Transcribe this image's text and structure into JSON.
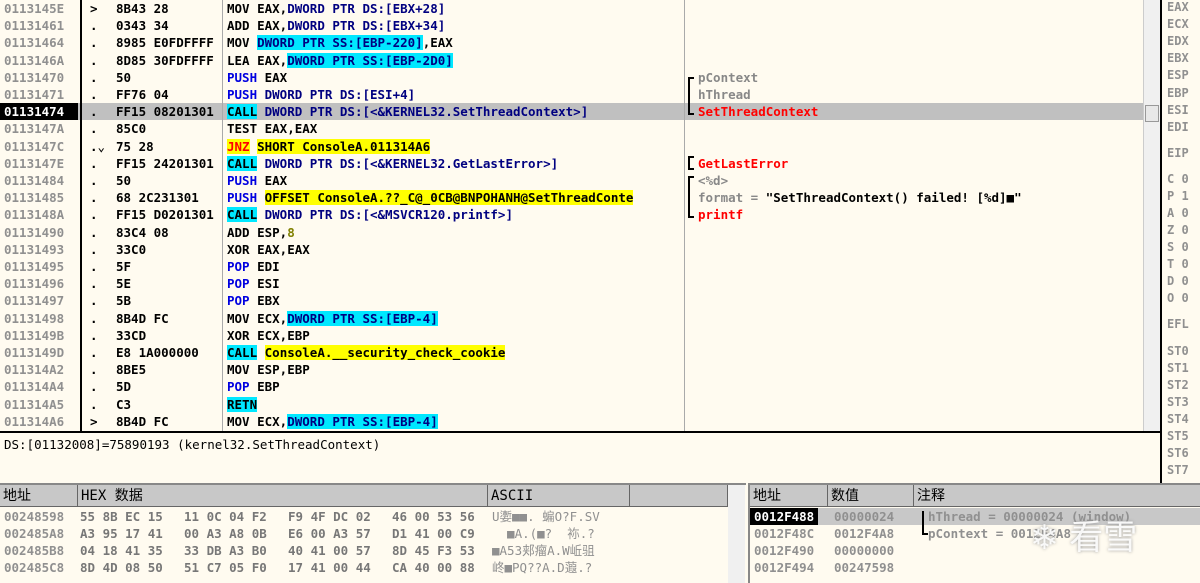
{
  "disasm": {
    "selected_index": 6,
    "rows": [
      {
        "addr": "0113145E",
        "mark": ">",
        "hex": "8B43 28",
        "asm": [
          [
            "MOV EAX,",
            "plain"
          ],
          [
            "DWORD PTR DS:[EBX+28]",
            "mem"
          ]
        ],
        "cmt": []
      },
      {
        "addr": "01131461",
        "mark": ".",
        "hex": "0343 34",
        "asm": [
          [
            "ADD EAX,",
            "plain"
          ],
          [
            "DWORD PTR DS:[EBX+34]",
            "mem"
          ]
        ],
        "cmt": []
      },
      {
        "addr": "01131464",
        "mark": ".",
        "hex": "8985 E0FDFFFF",
        "asm": [
          [
            "MOV ",
            "plain"
          ],
          [
            "DWORD PTR SS:[EBP-220]",
            "ss"
          ],
          [
            ",EAX",
            "plain"
          ]
        ],
        "cmt": []
      },
      {
        "addr": "0113146A",
        "mark": ".",
        "hex": "8D85 30FDFFFF",
        "asm": [
          [
            "LEA EAX,",
            "plain"
          ],
          [
            "DWORD PTR SS:[EBP-2D0]",
            "ss"
          ]
        ],
        "cmt": []
      },
      {
        "addr": "01131470",
        "mark": ".",
        "hex": "50",
        "asm": [
          [
            "PUSH",
            "push"
          ],
          [
            " EAX",
            "plain"
          ]
        ],
        "cmt": [
          [
            "pContext",
            "gray"
          ]
        ]
      },
      {
        "addr": "01131471",
        "mark": ".",
        "hex": "FF76 04",
        "asm": [
          [
            "PUSH",
            "push"
          ],
          [
            " DWORD PTR DS:[ESI+4]",
            "mem"
          ]
        ],
        "cmt": [
          [
            "hThread",
            "gray"
          ]
        ]
      },
      {
        "addr": "01131474",
        "mark": ".",
        "hex": "FF15 08201301",
        "asm": [
          [
            "CALL",
            "call"
          ],
          [
            " DWORD PTR DS:[<&KERNEL32.SetThreadContext>]",
            "mem"
          ]
        ],
        "cmt": [
          [
            "SetThreadContext",
            "red"
          ]
        ]
      },
      {
        "addr": "0113147A",
        "mark": ".",
        "hex": "85C0",
        "asm": [
          [
            "TEST EAX,EAX",
            "plain"
          ]
        ],
        "cmt": []
      },
      {
        "addr": "0113147C",
        "mark": ".⌄",
        "hex": "75 28",
        "asm": [
          [
            "JNZ",
            "jnz"
          ],
          [
            " ",
            "plain"
          ],
          [
            "SHORT ConsoleA.011314A6",
            "lbl"
          ]
        ],
        "cmt": []
      },
      {
        "addr": "0113147E",
        "mark": ".",
        "hex": "FF15 24201301",
        "asm": [
          [
            "CALL",
            "call"
          ],
          [
            " DWORD PTR DS:[<&KERNEL32.GetLastError>]",
            "mem"
          ]
        ],
        "cmt": [
          [
            "GetLastError",
            "red"
          ]
        ]
      },
      {
        "addr": "01131484",
        "mark": ".",
        "hex": "50",
        "asm": [
          [
            "PUSH",
            "push"
          ],
          [
            " EAX",
            "plain"
          ]
        ],
        "cmt": [
          [
            "<%d>",
            "gray"
          ]
        ]
      },
      {
        "addr": "01131485",
        "mark": ".",
        "hex": "68 2C231301",
        "asm": [
          [
            "PUSH",
            "push"
          ],
          [
            " ",
            "plain"
          ],
          [
            "OFFSET ConsoleA.??_C@_0CB@BNPOHANH@SetThreadConte",
            "lbl"
          ]
        ],
        "cmt": [
          [
            "format = ",
            "gray"
          ],
          [
            "\"SetThreadContext() failed! [%d]■\"",
            "str"
          ]
        ]
      },
      {
        "addr": "0113148A",
        "mark": ".",
        "hex": "FF15 D0201301",
        "asm": [
          [
            "CALL",
            "call"
          ],
          [
            " DWORD PTR DS:[<&MSVCR120.printf>]",
            "mem"
          ]
        ],
        "cmt": [
          [
            "printf",
            "red"
          ]
        ]
      },
      {
        "addr": "01131490",
        "mark": ".",
        "hex": "83C4 08",
        "asm": [
          [
            "ADD ESP,",
            "plain"
          ],
          [
            "8",
            "num"
          ]
        ],
        "cmt": []
      },
      {
        "addr": "01131493",
        "mark": ".",
        "hex": "33C0",
        "asm": [
          [
            "XOR EAX,EAX",
            "plain"
          ]
        ],
        "cmt": []
      },
      {
        "addr": "01131495",
        "mark": ".",
        "hex": "5F",
        "asm": [
          [
            "POP",
            "push"
          ],
          [
            " EDI",
            "plain"
          ]
        ],
        "cmt": []
      },
      {
        "addr": "01131496",
        "mark": ".",
        "hex": "5E",
        "asm": [
          [
            "POP",
            "push"
          ],
          [
            " ESI",
            "plain"
          ]
        ],
        "cmt": []
      },
      {
        "addr": "01131497",
        "mark": ".",
        "hex": "5B",
        "asm": [
          [
            "POP",
            "push"
          ],
          [
            " EBX",
            "plain"
          ]
        ],
        "cmt": []
      },
      {
        "addr": "01131498",
        "mark": ".",
        "hex": "8B4D FC",
        "asm": [
          [
            "MOV ECX,",
            "plain"
          ],
          [
            "DWORD PTR SS:[EBP-4]",
            "ss"
          ]
        ],
        "cmt": []
      },
      {
        "addr": "0113149B",
        "mark": ".",
        "hex": "33CD",
        "asm": [
          [
            "XOR ECX,EBP",
            "plain"
          ]
        ],
        "cmt": []
      },
      {
        "addr": "0113149D",
        "mark": ".",
        "hex": "E8 1A000000",
        "asm": [
          [
            "CALL",
            "call"
          ],
          [
            " ",
            "plain"
          ],
          [
            "ConsoleA.__security_check_cookie",
            "lbl"
          ]
        ],
        "cmt": []
      },
      {
        "addr": "011314A2",
        "mark": ".",
        "hex": "8BE5",
        "asm": [
          [
            "MOV ESP,EBP",
            "plain"
          ]
        ],
        "cmt": []
      },
      {
        "addr": "011314A4",
        "mark": ".",
        "hex": "5D",
        "asm": [
          [
            "POP",
            "push"
          ],
          [
            " EBP",
            "plain"
          ]
        ],
        "cmt": []
      },
      {
        "addr": "011314A5",
        "mark": ".",
        "hex": "C3",
        "asm": [
          [
            "RETN",
            "call"
          ]
        ],
        "cmt": []
      },
      {
        "addr": "011314A6",
        "mark": ">",
        "hex": "8B4D FC",
        "asm": [
          [
            "MOV ECX,",
            "plain"
          ],
          [
            "DWORD PTR SS:[EBP-4]",
            "ss"
          ]
        ],
        "cmt": []
      }
    ]
  },
  "registers": [
    "EAX",
    "ECX",
    "EDX",
    "EBX",
    "ESP",
    "EBP",
    "ESI",
    "EDI",
    "EIP",
    "C 0",
    "P 1",
    "A 0",
    "Z 0",
    "S 0",
    "T 0",
    "D 0",
    "O 0",
    "EFL",
    "ST0",
    "ST1",
    "ST2",
    "ST3",
    "ST4",
    "ST5",
    "ST6",
    "ST7"
  ],
  "info": {
    "text": "DS:[01132008]=75890193 (kernel32.SetThreadContext)"
  },
  "dump": {
    "headers": {
      "address": "地址",
      "hex": "HEX 数据",
      "ascii": "ASCII"
    },
    "rows": [
      {
        "addr": "00248598",
        "hex": [
          "55 8B EC 15",
          "11 0C 04 F2",
          "F9 4F DC 02",
          "46 00 53 56"
        ],
        "ascii": "U嬱■■. 蝙O?F.SV"
      },
      {
        "addr": "002485A8",
        "hex": [
          "A3 95 17 41",
          "00 A3 A8 0B",
          "E6 00 A3 57",
          "D1 41 00 C9"
        ],
        "ascii": "  ■A.(■?  袮.?"
      },
      {
        "addr": "002485B8",
        "hex": [
          "04 18 41 35",
          "33 DB A3 B0",
          "40 41 00 57",
          "8D 45 F3 53"
        ],
        "ascii": "■A53郏瘤A.W岴驵"
      },
      {
        "addr": "002485C8",
        "hex": [
          "8D 4D 08 50",
          "51 C7 05 F0",
          "17 41 00 44",
          "CA 40 00 88"
        ],
        "ascii": "峂■PQ??A.D蕸.?"
      }
    ]
  },
  "stack": {
    "headers": {
      "address": "地址",
      "value": "数值",
      "comment": "注释"
    },
    "rows": [
      {
        "addr": "0012F488",
        "value": "00000024",
        "comment": "hThread = 00000024 (window)"
      },
      {
        "addr": "0012F48C",
        "value": "0012F4A8",
        "comment": "pContext = 0012F4A8"
      },
      {
        "addr": "0012F490",
        "value": "00000000",
        "comment": ""
      },
      {
        "addr": "0012F494",
        "value": "00247598",
        "comment": ""
      }
    ]
  },
  "watermark": "看雪"
}
